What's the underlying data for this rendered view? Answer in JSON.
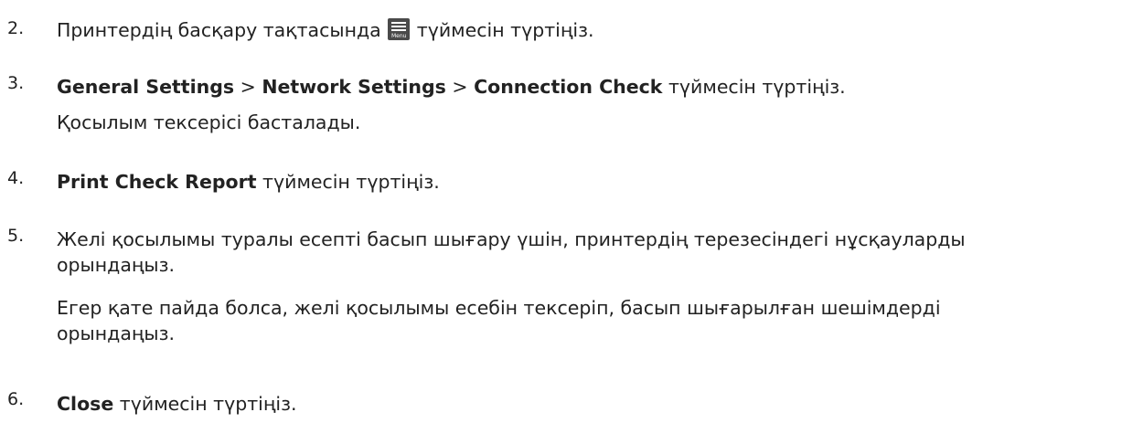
{
  "steps": [
    {
      "number": "2.",
      "text_before_icon": "Принтердің басқару тақтасында",
      "icon": "menu-icon",
      "icon_label": "Menu",
      "text_after_icon": "түймесін түртіңіз."
    },
    {
      "number": "3.",
      "path": [
        "General Settings",
        "Network Settings",
        "Connection Check"
      ],
      "separator": " > ",
      "suffix": "түймесін түртіңіз.",
      "note": "Қосылым тексерісі басталады."
    },
    {
      "number": "4.",
      "bold": "Print Check Report",
      "suffix": "түймесін түртіңіз."
    },
    {
      "number": "5.",
      "lines": [
        "Желі қосылымы туралы есепті басып шығару үшін, принтердің терезесіндегі нұсқауларды",
        "орындаңыз."
      ],
      "note_lines": [
        "Егер қате пайда болса, желі қосылымы есебін тексеріп, басып шығарылған шешімдерді",
        "орындаңыз."
      ]
    },
    {
      "number": "6.",
      "bold": "Close",
      "suffix": "түймесін түртіңіз."
    }
  ]
}
